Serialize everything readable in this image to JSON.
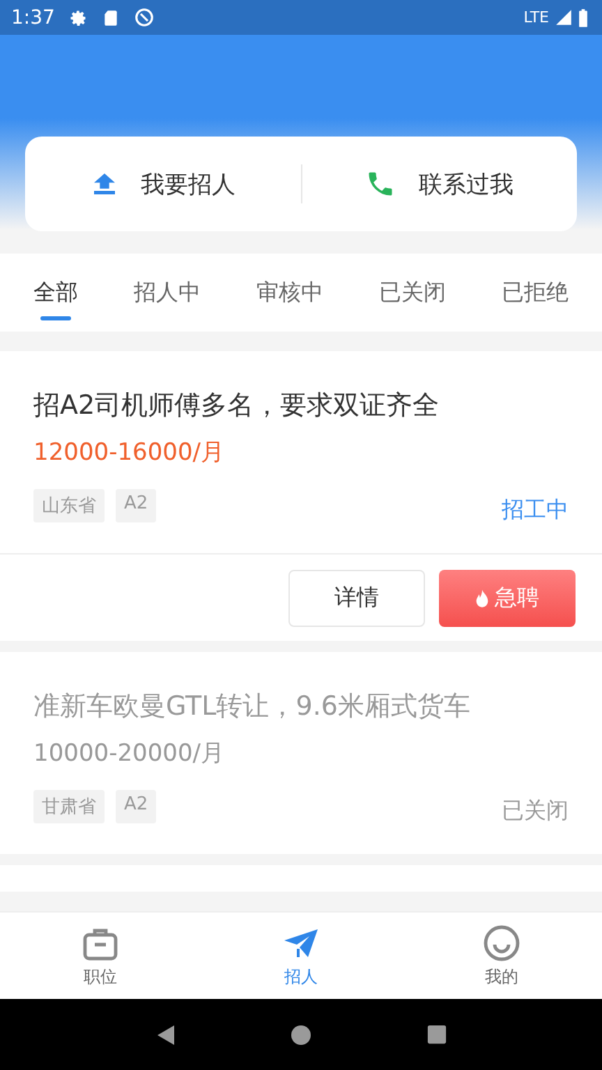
{
  "status_bar": {
    "time": "1:37",
    "network": "LTE"
  },
  "actions": [
    {
      "label": "我要招人",
      "kind": "post"
    },
    {
      "label": "联系过我",
      "kind": "phone"
    }
  ],
  "tabs": [
    {
      "label": "全部",
      "selected": true
    },
    {
      "label": "招人中",
      "selected": false
    },
    {
      "label": "审核中",
      "selected": false
    },
    {
      "label": "已关闭",
      "selected": false
    },
    {
      "label": "已拒绝",
      "selected": false
    }
  ],
  "jobs": [
    {
      "title": "招A2司机师傅多名，要求双证齐全",
      "salary": "12000-16000/月",
      "tags": [
        "山东省",
        "A2"
      ],
      "status": "招工中",
      "active": true,
      "buttons": [
        {
          "label": "详情",
          "kind": "outline"
        },
        {
          "label": "急聘",
          "kind": "urgent"
        }
      ]
    },
    {
      "title": "准新车欧曼GTL转让，9.6米厢式货车",
      "salary": "10000-20000/月",
      "tags": [
        "甘肃省",
        "A2"
      ],
      "status": "已关闭",
      "active": false
    }
  ],
  "bottom_nav": [
    {
      "label": "职位",
      "kind": "briefcase",
      "selected": false
    },
    {
      "label": "招人",
      "kind": "send",
      "selected": true
    },
    {
      "label": "我的",
      "kind": "smile",
      "selected": false
    }
  ]
}
